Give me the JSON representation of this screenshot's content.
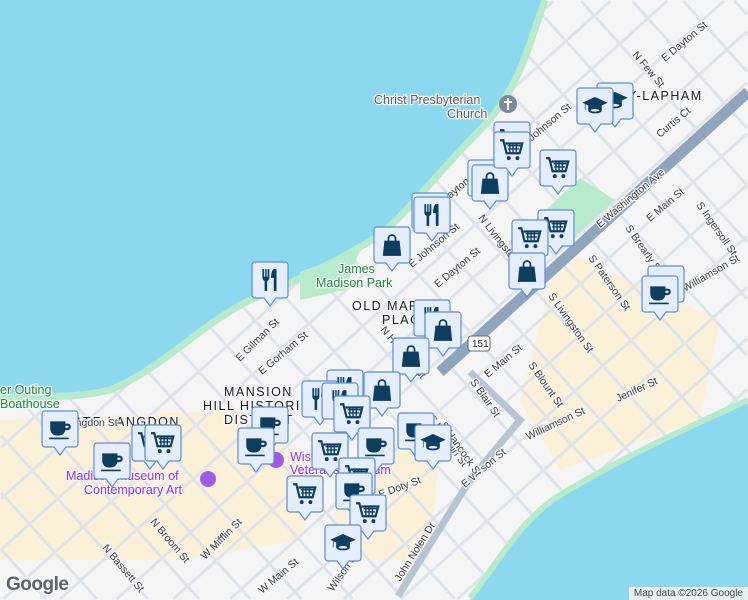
{
  "map": {
    "districts": [
      "TENNEY-LAPHAM",
      "OLD MARKET",
      "PLACE",
      "MANSION",
      "HILL HISTORIC",
      "DISTRICT",
      "STATE-LANGDON"
    ],
    "parks": [
      "James",
      "Madison Park",
      "er Outing",
      "Boathouse"
    ],
    "places": {
      "church_1": "Christ Presbyterian",
      "church_2": "Church",
      "museum_1": "Madison Museum of",
      "museum_2": "Contemporary Art",
      "vet_1": "Wisconsin",
      "vet_2": "Veterans Museum"
    },
    "streets": [
      "E Gorham St",
      "E Gilman St",
      "E Johnson St",
      "E Dayton St",
      "N Livingston St",
      "E Washington Ave",
      "S Brearly St",
      "E Main St",
      "S Ingersoll St",
      "S Paterson St",
      "S Livingston St",
      "Williamson St",
      "Williamson St",
      "Jenifer St",
      "E Main St",
      "S Blount St",
      "S Blair St",
      "S Franklin St",
      "E Wilson St",
      "N Broom St",
      "N Bassett St",
      "W Mifflin St",
      "W Main St",
      "E Doty St",
      "John Nolen Dr",
      "Wilson St",
      "Curtis Ct",
      "N Few St",
      "E Dayton St",
      "E Johnson St",
      "Langdon St",
      "E Dayton St",
      "N Hancock St",
      "S Hancock St"
    ],
    "route_shield": "151",
    "marker_types": [
      "restaurant-icon",
      "shopping-bag-icon",
      "grocery-cart-icon",
      "coffee-icon",
      "school-icon"
    ],
    "colors": {
      "water": "#8cd9ef",
      "park": "#b7ebcc",
      "marker_bg": "#e4eefc",
      "marker_border": "#5b8fd9",
      "marker_icon": "#0d3d5f",
      "highway": "#8fa4bd"
    }
  },
  "attribution": "Map data ©2026 Google",
  "logo": "Google"
}
